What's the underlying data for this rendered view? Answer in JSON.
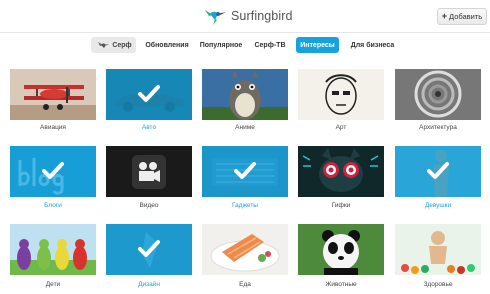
{
  "header": {
    "brand": "Surfingbird",
    "add_button": "Добавить",
    "colors": {
      "accent": "#16a3dd",
      "selected_overlay": "#16a3dd"
    }
  },
  "nav": {
    "surf": "Серф",
    "items": [
      {
        "label": "Обновления",
        "active": false
      },
      {
        "label": "Популярное",
        "active": false
      },
      {
        "label": "Серф-ТВ",
        "active": false
      },
      {
        "label": "Интересы",
        "active": true
      },
      {
        "label": "Для бизнеса",
        "active": false
      }
    ]
  },
  "categories": [
    {
      "label": "Авиация",
      "selected": false,
      "icon": "biplane"
    },
    {
      "label": "Авто",
      "selected": true,
      "icon": "car"
    },
    {
      "label": "Аниме",
      "selected": false,
      "icon": "totoro"
    },
    {
      "label": "Арт",
      "selected": false,
      "icon": "sketch-face"
    },
    {
      "label": "Архитектура",
      "selected": false,
      "icon": "spiral-stairs"
    },
    {
      "label": "Блоги",
      "selected": true,
      "icon": "blog-word"
    },
    {
      "label": "Видео",
      "selected": false,
      "icon": "video-camera"
    },
    {
      "label": "Гаджеты",
      "selected": true,
      "icon": "keyboard"
    },
    {
      "label": "Гифки",
      "selected": false,
      "icon": "cat-hypno"
    },
    {
      "label": "Девушки",
      "selected": true,
      "icon": "girl"
    },
    {
      "label": "Дети",
      "selected": false,
      "icon": "teletubbies"
    },
    {
      "label": "Дизайн",
      "selected": true,
      "icon": "design-figure"
    },
    {
      "label": "Еда",
      "selected": false,
      "icon": "salmon-dish"
    },
    {
      "label": "Животные",
      "selected": false,
      "icon": "panda"
    },
    {
      "label": "Здоровье",
      "selected": false,
      "icon": "healthy-food"
    }
  ]
}
